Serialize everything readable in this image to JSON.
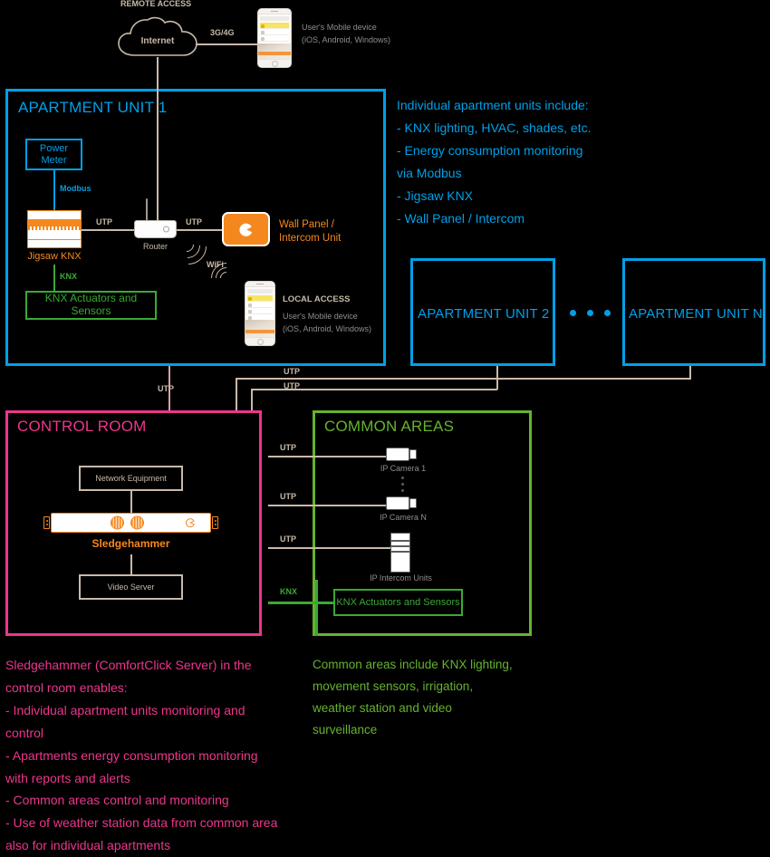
{
  "remote_access": {
    "label": "REMOTE ACCESS",
    "cloud_label": "Internet",
    "link_label": "3G/4G",
    "mobile_caption": "User's Mobile device\n(iOS, Android, Windows)"
  },
  "apartment_unit_1": {
    "title": "APARTMENT UNIT 1",
    "power_meter": "Power\nMeter",
    "modbus_label": "Modbus",
    "jigsaw_label": "Jigsaw KNX",
    "utp_left_label": "UTP",
    "utp_right_label": "UTP",
    "router_label": "Router",
    "wall_panel_label": "Wall Panel /\nIntercom Unit",
    "knx_label": "KNX",
    "knx_actuators": "KNX Actuators and Sensors",
    "wifi_label": "WiFi",
    "local_access_title": "LOCAL ACCESS",
    "local_access_caption": "User's Mobile device\n(iOS, Android, Windows)"
  },
  "units_note": {
    "text": "Individual apartment  units include:\n- KNX lighting, HVAC, shades, etc.\n- Energy consumption monitoring\nvia Modbus\n- Jigsaw KNX\n- Wall Panel / Intercom"
  },
  "apartment_unit_2": {
    "title": "APARTMENT UNIT 2"
  },
  "apartment_unit_n": {
    "title": "APARTMENT UNIT N"
  },
  "trunk_labels": {
    "utp_control_room": "UTP",
    "utp_upper": "UTP",
    "utp_lower": "UTP"
  },
  "control_room": {
    "title": "CONTROL ROOM",
    "network_equipment": "Network Equipment",
    "server_label": "Sledgehammer",
    "video_server": "Video Server"
  },
  "common_areas": {
    "title": "COMMON AREAS",
    "camera_1": "IP Camera 1",
    "camera_n": "IP Camera N",
    "intercom_units": "IP Intercom Units",
    "knx_actuators": "KNX Actuators and Sensors",
    "utp_1": "UTP",
    "utp_2": "UTP",
    "utp_3": "UTP",
    "knx": "KNX"
  },
  "control_room_note": {
    "text": "Sledgehammer (ComfortClick Server) in the\ncontrol room enables:\n- Individual apartment units monitoring and\ncontrol\n- Apartments energy consumption monitoring\nwith reports and alerts\n- Common areas control and monitoring\n- Use of weather station data from common area\nalso for individual apartments"
  },
  "common_areas_note": {
    "text": "Common areas include KNX lighting,\nmovement sensors, irrigation,\nweather station and video\nsurveillance"
  },
  "colors": {
    "blue": "#00a0e8",
    "pink": "#ec368d",
    "green": "#66b32e",
    "orange": "#f5871f",
    "tan": "#c9b9a8",
    "knx_green": "#3aa935"
  }
}
